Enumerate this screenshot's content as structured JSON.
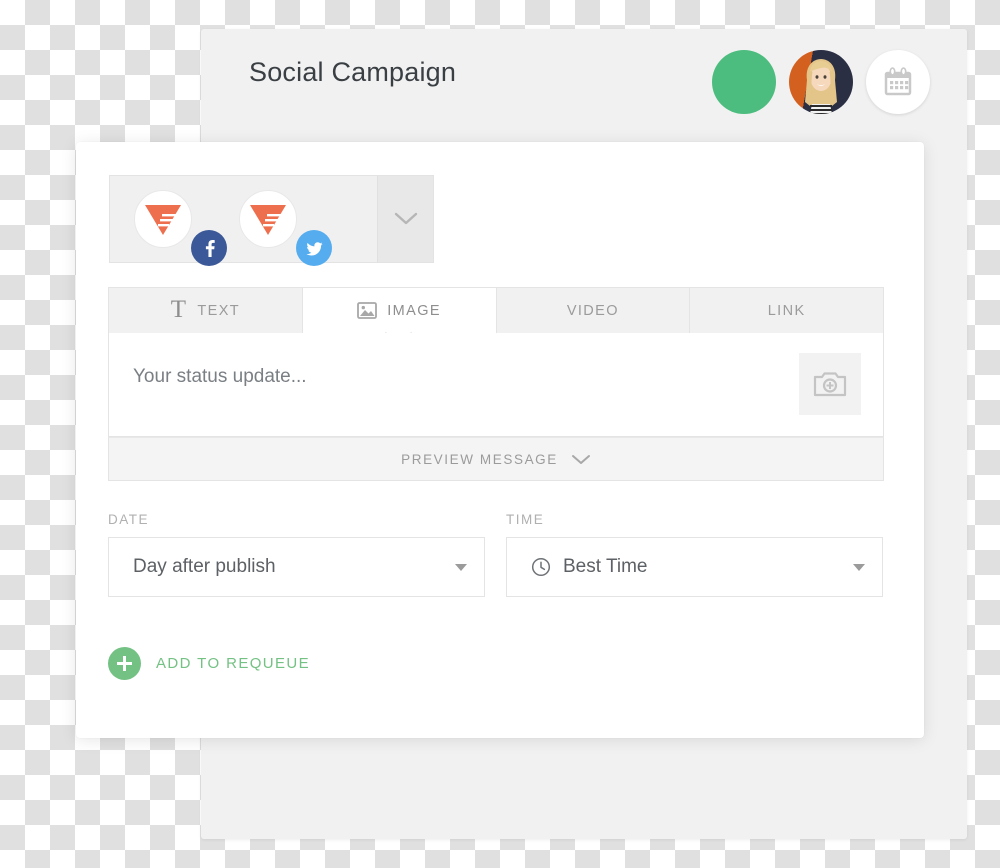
{
  "header": {
    "title": "Social Campaign",
    "status_dot_color": "#4cbd7e",
    "avatar_name": "user-avatar",
    "calendar_icon": "calendar-icon"
  },
  "composer": {
    "accounts": [
      {
        "brand_icon": "brand-logo-icon",
        "network": "facebook",
        "network_label": "Facebook"
      },
      {
        "brand_icon": "brand-logo-icon",
        "network": "twitter",
        "network_label": "Twitter"
      }
    ],
    "expand_icon": "chevron-down-icon",
    "tabs": [
      {
        "label": "TEXT",
        "icon": "text-t-icon",
        "active": false
      },
      {
        "label": "IMAGE",
        "icon": "picture-icon",
        "active": true
      },
      {
        "label": "VIDEO",
        "icon": "",
        "active": false
      },
      {
        "label": "LINK",
        "icon": "",
        "active": false
      }
    ],
    "status_placeholder": "Your status update...",
    "add_image_icon": "camera-add-icon",
    "preview": {
      "label": "PREVIEW MESSAGE",
      "icon": "chevron-down-icon"
    },
    "date": {
      "label": "DATE",
      "value": "Day after publish",
      "caret": "caret-down-icon"
    },
    "time": {
      "label": "TIME",
      "value": "Best Time",
      "icon": "clock-icon",
      "caret": "caret-down-icon"
    },
    "requeue": {
      "label": "ADD TO REQUEUE",
      "icon": "plus-circle-icon",
      "color": "#74c184"
    }
  },
  "colors": {
    "brand_coral": "#ee6f4e",
    "facebook_blue": "#3b5998",
    "twitter_blue": "#55acee",
    "green_accent": "#74c184",
    "panel_gray": "#f1f1f1"
  }
}
